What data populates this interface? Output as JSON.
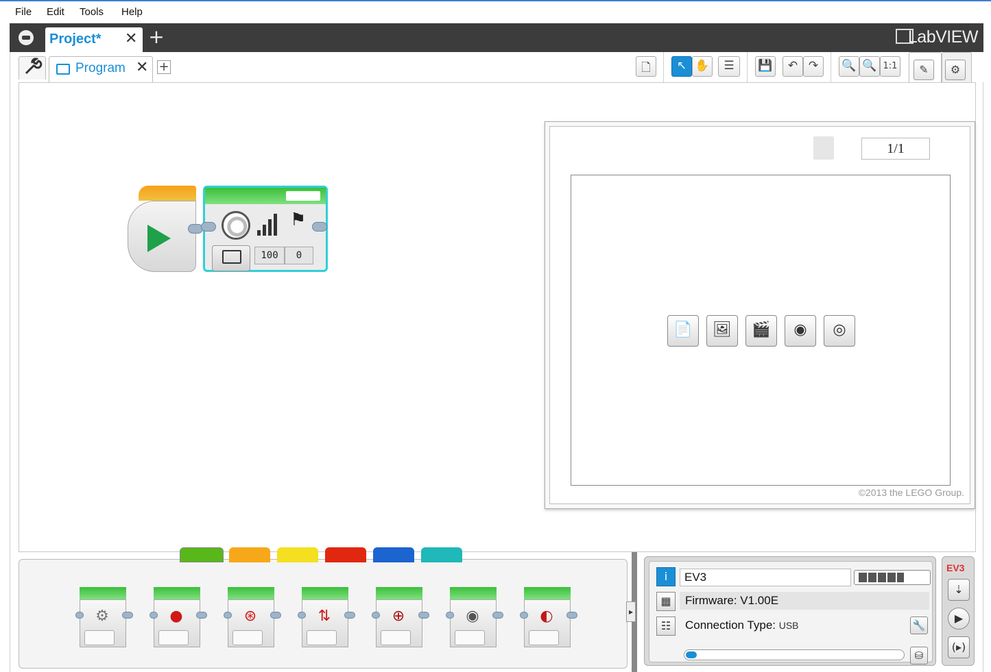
{
  "menu": {
    "items": [
      "File",
      "Edit",
      "Tools",
      "Help"
    ]
  },
  "project_bar": {
    "home_icon": "home-icon",
    "tab_label": "Project*",
    "close_glyph": "✕",
    "add_glyph": "+",
    "brand": "LabVIEW"
  },
  "program_tabs": {
    "wrench_icon": "wrench-icon",
    "tab_label": "Program",
    "close_glyph": "✕",
    "add_glyph": "+"
  },
  "toolbar": {
    "buttons": [
      {
        "name": "content-editor-icon",
        "glyph": "🗋"
      },
      {
        "name": "pointer-icon",
        "glyph": "↖"
      },
      {
        "name": "pan-hand-icon",
        "glyph": "✋"
      },
      {
        "name": "comment-icon",
        "glyph": "☰"
      },
      {
        "name": "save-icon",
        "glyph": "💾"
      },
      {
        "name": "undo-icon",
        "glyph": "↶"
      },
      {
        "name": "redo-icon",
        "glyph": "↷"
      },
      {
        "name": "zoom-out-icon",
        "glyph": "🔍"
      },
      {
        "name": "zoom-in-icon",
        "glyph": "🔍"
      },
      {
        "name": "zoom-reset",
        "glyph": "1:1"
      }
    ]
  },
  "side_tabs": [
    {
      "name": "edit-tab-icon",
      "glyph": "✎"
    },
    {
      "name": "settings-tab-icon",
      "glyph": "⚙"
    }
  ],
  "program": {
    "sound_block": {
      "volume": "100",
      "play_type": "0"
    }
  },
  "display_panel": {
    "page_indicator": "1/1",
    "media_icons": [
      {
        "name": "text-file-icon",
        "glyph": "📄"
      },
      {
        "name": "image-icon",
        "glyph": "🖼"
      },
      {
        "name": "video-clapper-icon",
        "glyph": "🎬"
      },
      {
        "name": "sound-icon",
        "glyph": "◉"
      },
      {
        "name": "webcam-icon",
        "glyph": "◎"
      }
    ],
    "copyright": "©2013 the LEGO Group."
  },
  "palette": {
    "tabs": [
      {
        "name": "palette-tab-action",
        "color": "#58b81a",
        "active": true
      },
      {
        "name": "palette-tab-flow",
        "color": "#f7a81a"
      },
      {
        "name": "palette-tab-sensor",
        "color": "#f4e020"
      },
      {
        "name": "palette-tab-data",
        "color": "#e02810"
      },
      {
        "name": "palette-tab-advanced",
        "color": "#1c64d0"
      },
      {
        "name": "palette-tab-myblocks",
        "color": "#20b8b8"
      }
    ],
    "blocks": [
      {
        "name": "medium-motor-block",
        "glyph": "⚙"
      },
      {
        "name": "large-motor-block",
        "glyph": "●"
      },
      {
        "name": "move-steering-block",
        "glyph": "⊛"
      },
      {
        "name": "move-tank-block",
        "glyph": "⇅"
      },
      {
        "name": "display-block",
        "glyph": "⊕"
      },
      {
        "name": "sound-block",
        "glyph": "◉"
      },
      {
        "name": "brick-status-light-block",
        "glyph": "◐"
      }
    ]
  },
  "hardware": {
    "brick_name": "EV3",
    "firmware": "Firmware: V1.00E",
    "connection_label": "Connection Type:",
    "connection_value": "USB",
    "battery_level": 0.8,
    "memory_used": 0.05,
    "ev3_label": "EV3"
  },
  "colors": {
    "accent": "#1a8fd6",
    "dark_bar": "#3c3c3c",
    "block_cyan": "#2fd0d8",
    "start_green": "#1fa04a"
  }
}
